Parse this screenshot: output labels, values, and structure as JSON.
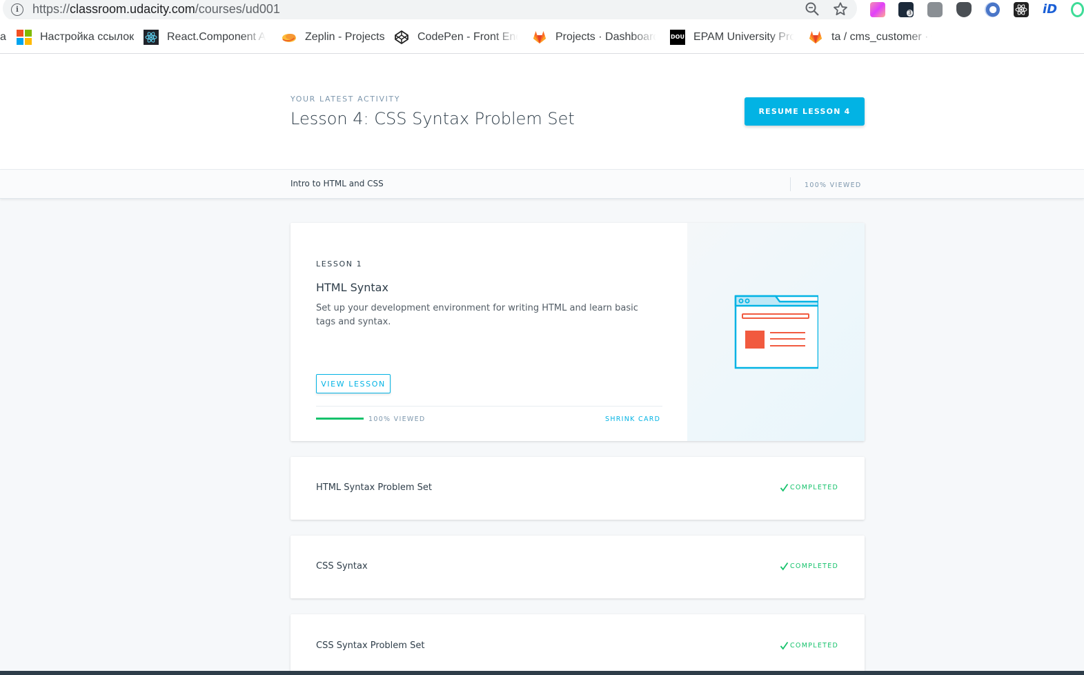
{
  "browser": {
    "url_prefix": "https://",
    "url_host": "classroom.udacity.com",
    "url_path": "/courses/ud001",
    "bookmarks": [
      {
        "label": "Настройка ссылок",
        "icon": "microsoft-icon"
      },
      {
        "label": "React.Component AP",
        "icon": "react-icon"
      },
      {
        "label": "Zeplin - Projects",
        "icon": "zeplin-icon"
      },
      {
        "label": "CodePen - Front End",
        "icon": "codepen-icon"
      },
      {
        "label": "Projects · Dashboard",
        "icon": "gitlab-icon"
      },
      {
        "label": "EPAM University Prog",
        "icon": "dou-icon"
      },
      {
        "label": "ta / cms_customer · G",
        "icon": "gitlab-icon"
      }
    ],
    "left_clip_text": "а",
    "dou_icon_text": "DOU",
    "extension_badge": "3"
  },
  "activity": {
    "kicker": "YOUR LATEST ACTIVITY",
    "title": "Lesson 4: CSS Syntax Problem Set",
    "resume_label": "RESUME LESSON 4"
  },
  "course": {
    "name": "Intro to HTML and CSS",
    "progress_label": "100% VIEWED",
    "progress": 1.0
  },
  "lesson_card": {
    "kicker": "LESSON 1",
    "title": "HTML Syntax",
    "description": "Set up your development environment for writing HTML and learn basic tags and syntax.",
    "view_label": "VIEW LESSON",
    "progress": 1.0,
    "progress_label": "100% VIEWED",
    "shrink_label": "SHRINK CARD",
    "illustration": "browser-window-icon"
  },
  "concepts": [
    {
      "title": "HTML Syntax Problem Set",
      "status": "COMPLETED"
    },
    {
      "title": "CSS Syntax",
      "status": "COMPLETED"
    },
    {
      "title": "CSS Syntax Problem Set",
      "status": "COMPLETED"
    }
  ],
  "colors": {
    "accent": "#02b3e4",
    "success": "#15c26b",
    "text": "#2e3d49",
    "muted": "#7d97ad",
    "illustration_red": "#f15a3f"
  }
}
